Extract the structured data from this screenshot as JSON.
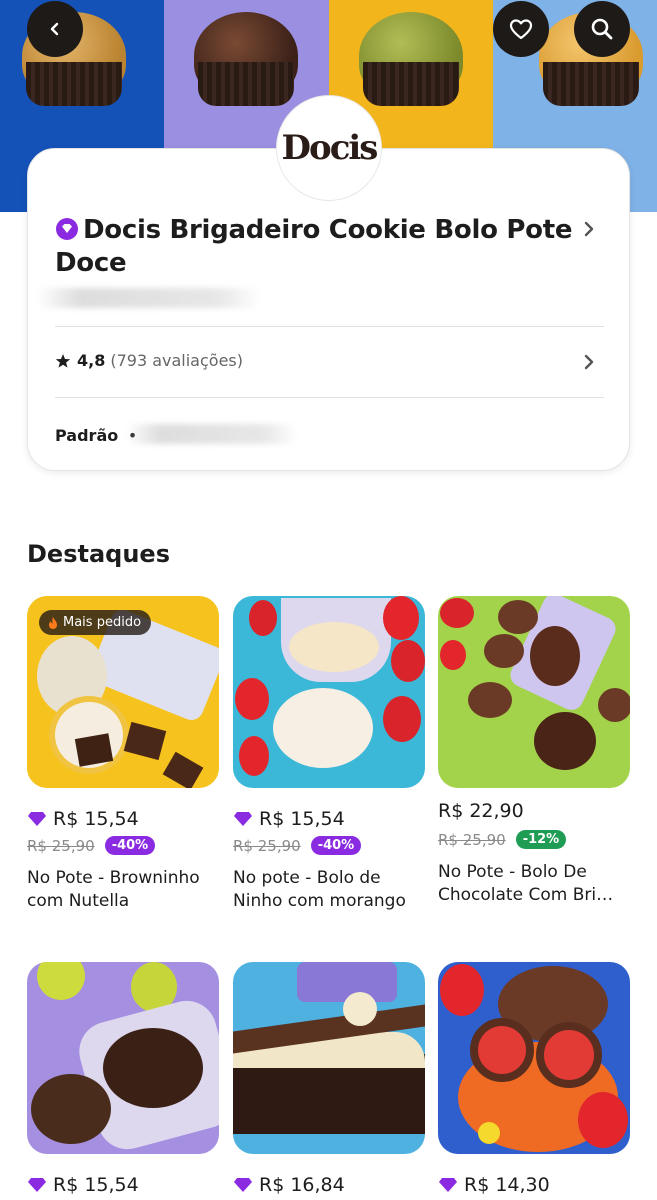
{
  "store": {
    "logo_text": "Docis",
    "name": "Docis Brigadeiro Cookie Bolo Pote Doce",
    "rating": "4,8",
    "reviews": "(793 avaliações)",
    "delivery_mode": "Padrão",
    "mode_separator": "•"
  },
  "section": {
    "title": "Destaques"
  },
  "products": [
    {
      "name": "No Pote - Browninho com Nutella",
      "price": "R$ 15,54",
      "old_price": "R$ 25,90",
      "discount": "-40%",
      "discount_color": "#8a2be2",
      "loyalty": true,
      "tag": "Mais pedido"
    },
    {
      "name": "No pote - Bolo de Ninho com morango",
      "price": "R$ 15,54",
      "old_price": "R$ 25,90",
      "discount": "-40%",
      "discount_color": "#8a2be2",
      "loyalty": true
    },
    {
      "name": "No Pote - Bolo De Chocolate Com Bri…",
      "price": "R$ 22,90",
      "old_price": "R$ 25,90",
      "discount": "-12%",
      "discount_color": "#1f9d55",
      "loyalty": false
    },
    {
      "price": "R$ 15,54",
      "loyalty": true
    },
    {
      "price": "R$ 16,84",
      "loyalty": true
    },
    {
      "price": "R$ 14,30",
      "loyalty": true
    }
  ],
  "colors": {
    "accent_purple": "#8a2be2",
    "discount_green": "#1f9d55",
    "button_dark": "#1e1a18"
  },
  "icons": [
    "back-arrow-icon",
    "heart-icon",
    "search-icon",
    "store-badge-icon",
    "chevron-right-icon",
    "star-icon",
    "fire-icon",
    "diamond-icon"
  ]
}
